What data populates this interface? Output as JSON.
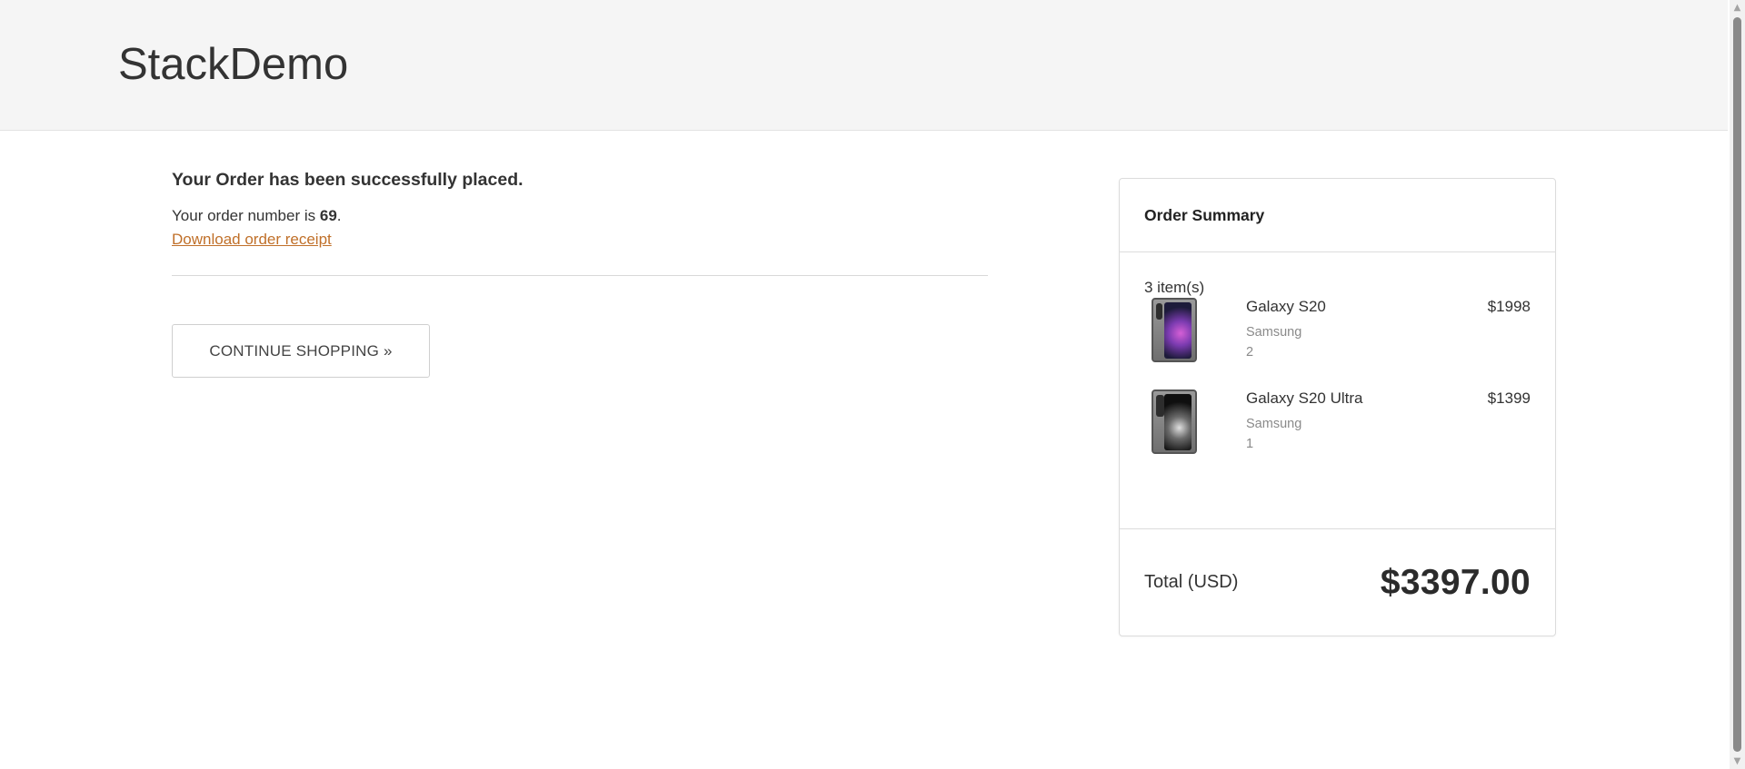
{
  "header": {
    "brand": "StackDemo"
  },
  "confirmation": {
    "title": "Your Order has been successfully placed.",
    "order_prefix": "Your order number is ",
    "order_number": "69",
    "order_suffix": ".",
    "receipt_link": "Download order receipt",
    "continue_button": "CONTINUE SHOPPING »"
  },
  "summary": {
    "title": "Order Summary",
    "items_count": "3 item(s)",
    "items": [
      {
        "name": "Galaxy S20",
        "brand": "Samsung",
        "quantity": "2",
        "price": "$1998",
        "thumbnail": "galaxy-s20-phone-image"
      },
      {
        "name": "Galaxy S20 Ultra",
        "brand": "Samsung",
        "quantity": "1",
        "price": "$1399",
        "thumbnail": "galaxy-s20-ultra-phone-image"
      }
    ],
    "total_label": "Total (USD)",
    "total_value": "$3397.00"
  },
  "colors": {
    "link": "#c0702a",
    "header_bg": "#f5f5f5",
    "text": "#333333"
  },
  "scrollbar": {
    "up_icon": "▲",
    "down_icon": "▼"
  }
}
